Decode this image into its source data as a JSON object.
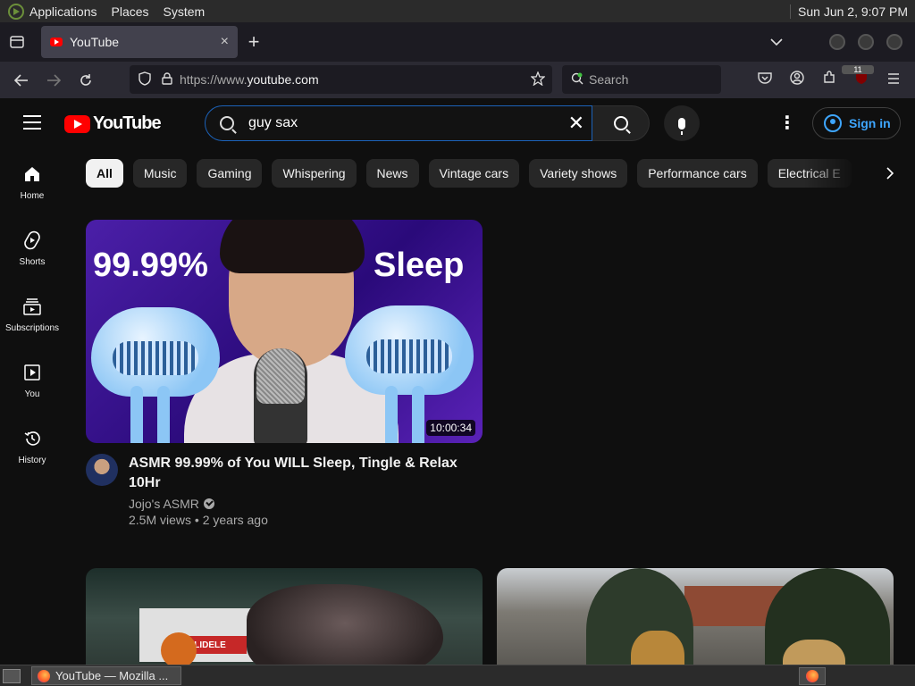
{
  "os": {
    "menus": [
      "Applications",
      "Places",
      "System"
    ],
    "clock": "Sun Jun  2,  9:07 PM"
  },
  "browser": {
    "tab_title": "YouTube",
    "tab_close": "×",
    "new_tab": "+",
    "url_prefix": "https://www.",
    "url_domain": "youtube.com",
    "search_placeholder": "Search",
    "ublock_badge": "11"
  },
  "youtube": {
    "logo_text": "YouTube",
    "search_value": "guy sax",
    "sign_in": "Sign in",
    "sidebar": [
      {
        "label": "Home",
        "icon": "home-icon"
      },
      {
        "label": "Shorts",
        "icon": "shorts-icon"
      },
      {
        "label": "Subscriptions",
        "icon": "subscriptions-icon"
      },
      {
        "label": "You",
        "icon": "you-icon"
      },
      {
        "label": "History",
        "icon": "history-icon"
      }
    ],
    "chips": [
      "All",
      "Music",
      "Gaming",
      "Whispering",
      "News",
      "Vintage cars",
      "Variety shows",
      "Performance cars",
      "Electrical E"
    ],
    "video": {
      "thumb_text_left": "99.99%",
      "thumb_text_right": "Sleep",
      "duration": "10:00:34",
      "title": "ASMR 99.99% of You WILL Sleep, Tingle & Relax 10Hr",
      "channel": "Jojo's ASMR",
      "stats": "2.5M views • 2 years ago"
    },
    "thumb2_sign": "BLIDELE"
  },
  "taskbar": {
    "task_label": "YouTube — Mozilla ..."
  },
  "colors": {
    "yt_red": "#ff0000",
    "link_blue": "#3ea6ff",
    "bg": "#0f0f0f"
  }
}
